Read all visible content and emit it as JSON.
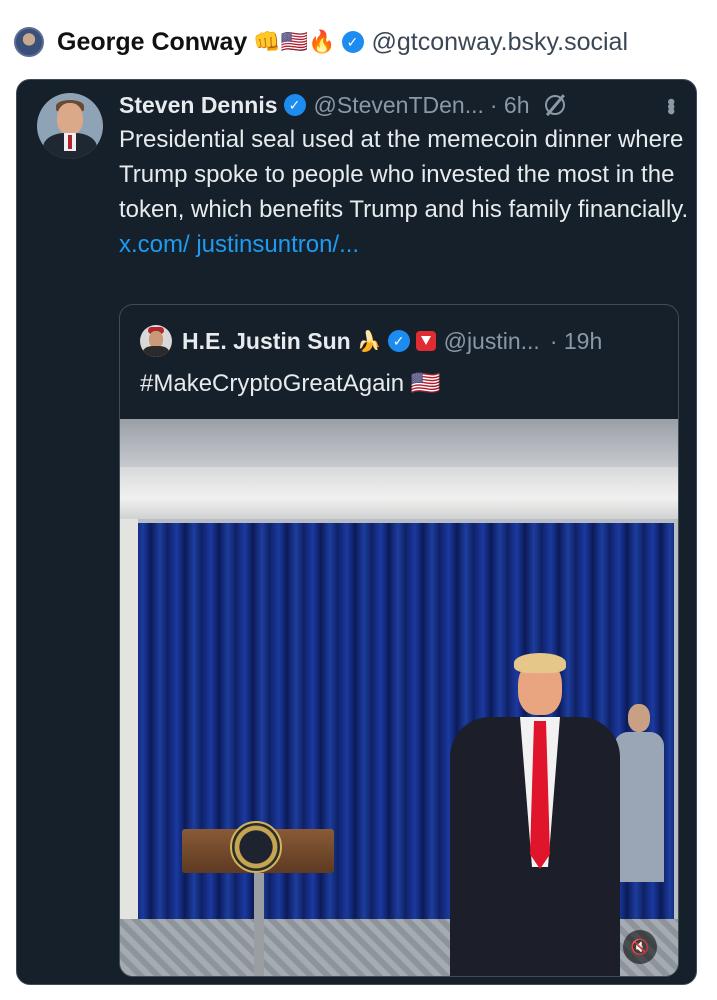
{
  "outer_post": {
    "author_name": "George Conway",
    "emojis": "👊🇺🇸🔥",
    "handle": "@gtconway.bsky.social"
  },
  "post": {
    "author_name": "Steven Dennis",
    "handle": "@StevenTDen...",
    "time": "· 6h",
    "text": "Presidential seal used at the memecoin dinner where Trump spoke to people who invested the most in the token, which benefits Trump and his family financially.",
    "link_text": "x.com/ justinsuntron/..."
  },
  "quoted_post": {
    "author_name": "H.E. Justin Sun",
    "emoji": "🍌",
    "handle": "@justin...",
    "time": "· 19h",
    "text": "#MakeCryptoGreatAgain 🇺🇸"
  },
  "video": {
    "mute_icon_glyph": "🔇"
  },
  "icons": {
    "outer_avatar": "avatar",
    "verified": "verified-badge-icon",
    "grok": "grok-icon",
    "more": "more-options-icon",
    "tron": "tron-badge-icon",
    "mute": "mute-icon"
  },
  "colors": {
    "card_bg": "#16202b",
    "link": "#1d9bf0",
    "verified": "#1d8cf0",
    "secondary_text": "#8b98a5"
  }
}
